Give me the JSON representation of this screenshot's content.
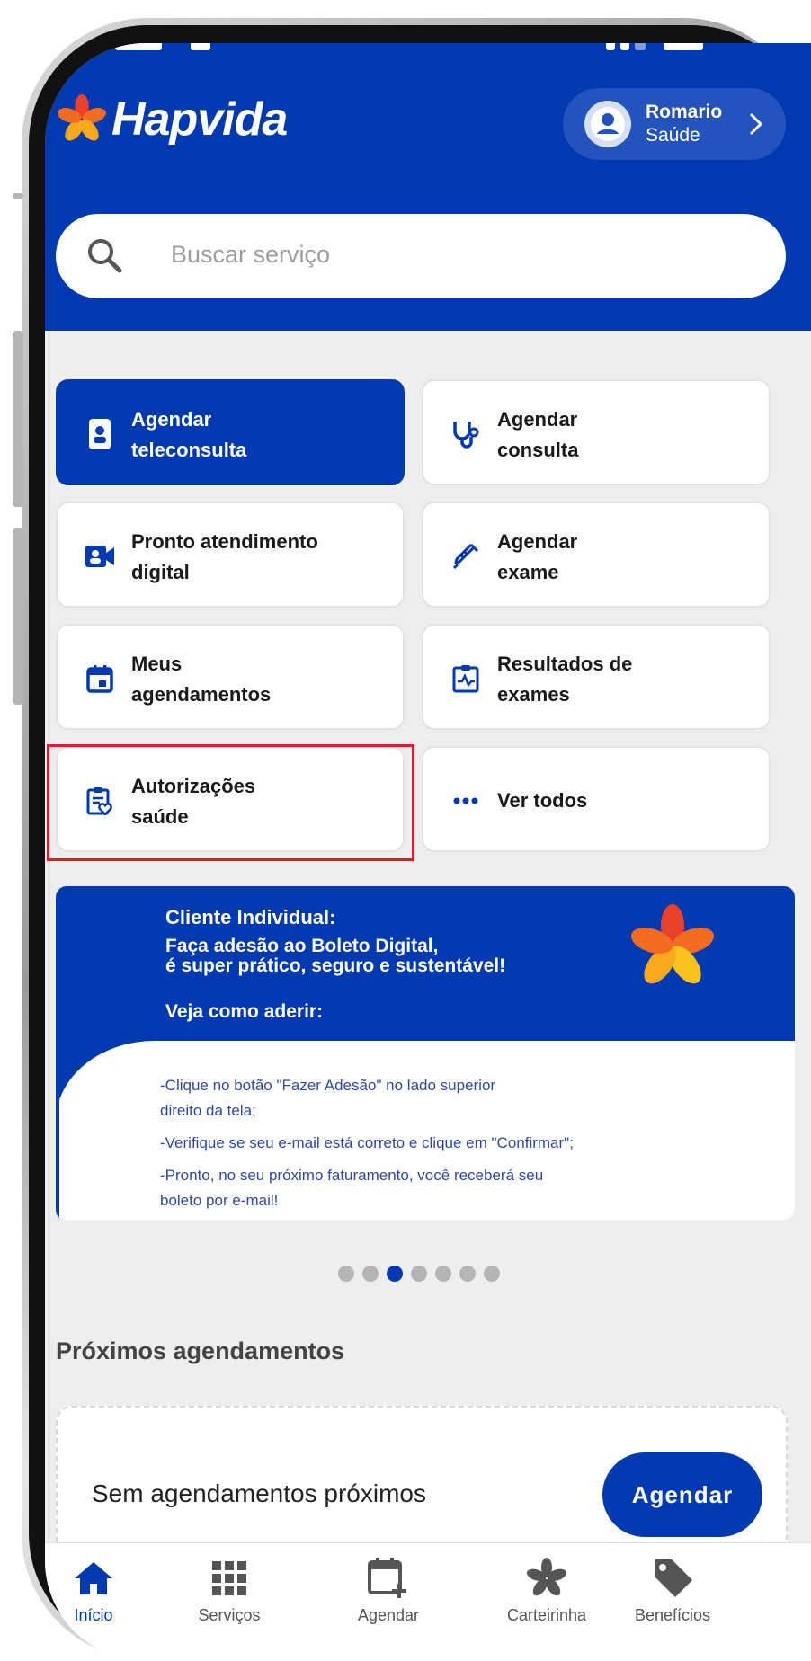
{
  "app": {
    "brand": "Hapvida"
  },
  "colors": {
    "primary": "#0039b0",
    "highlight": "#e11d2a",
    "background": "#eeeeee"
  },
  "profile": {
    "name": "Romario",
    "plan": "Saúde"
  },
  "search": {
    "placeholder": "Buscar serviço"
  },
  "services": [
    {
      "line1": "Agendar",
      "line2": "teleconsulta",
      "icon": "phone-doctor-icon",
      "primary": true
    },
    {
      "line1": "Agendar",
      "line2": "consulta",
      "icon": "stethoscope-icon"
    },
    {
      "line1": "Pronto atendimento",
      "line2": "digital",
      "icon": "video-camera-icon"
    },
    {
      "line1": "Agendar",
      "line2": "exame",
      "icon": "syringe-icon"
    },
    {
      "line1": "Meus",
      "line2": "agendamentos",
      "icon": "calendar-icon"
    },
    {
      "line1": "Resultados de",
      "line2": "exames",
      "icon": "clipboard-pulse-icon"
    },
    {
      "line1": "Autorizações",
      "line2": "saúde",
      "icon": "clipboard-heart-icon",
      "highlighted": true
    },
    {
      "line1": "Ver todos",
      "line2": "",
      "icon": "more-dots-icon"
    }
  ],
  "banner": {
    "title": "Cliente Individual:",
    "subtitle1": "Faça adesão ao Boleto Digital,",
    "subtitle2": "é super prático, seguro e sustentável!",
    "how": "Veja como aderir:",
    "step1a": "-Clique no botão \"Fazer Adesão\" no lado superior",
    "step1b": "direito da tela;",
    "step2": "-Verifique se seu e-mail está correto e clique em \"Confirmar\";",
    "step3a": "-Pronto, no seu próximo faturamento, você receberá seu",
    "step3b": "boleto por e-mail!"
  },
  "carousel": {
    "total": 7,
    "active": 3
  },
  "upcoming": {
    "title": "Próximos agendamentos",
    "empty_text": "Sem agendamentos próximos",
    "button": "Agendar"
  },
  "nav": [
    {
      "label": "Início",
      "icon": "home-icon",
      "active": true
    },
    {
      "label": "Serviços",
      "icon": "grid-icon"
    },
    {
      "label": "Agendar",
      "icon": "calendar-add-icon"
    },
    {
      "label": "Carteirinha",
      "icon": "card-flower-icon"
    },
    {
      "label": "Benefícios",
      "icon": "tag-icon"
    }
  ]
}
